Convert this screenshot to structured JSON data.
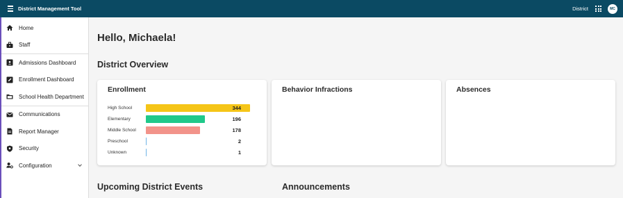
{
  "appbar": {
    "title": "District Management Tool",
    "district_label": "District",
    "avatar_initials": "MC",
    "color": "#0b4a63"
  },
  "sidebar": {
    "items": [
      {
        "label": "Home",
        "icon": "home-icon"
      },
      {
        "label": "Staff",
        "icon": "briefcase-icon"
      },
      {
        "label": "Admissions Dashboard",
        "icon": "inbox-icon"
      },
      {
        "label": "Enrollment Dashboard",
        "icon": "edit-icon"
      },
      {
        "label": "School Health Department",
        "icon": "folder-icon"
      },
      {
        "label": "Communications",
        "icon": "mail-icon"
      },
      {
        "label": "Report Manager",
        "icon": "document-icon"
      },
      {
        "label": "Security",
        "icon": "shield-icon"
      },
      {
        "label": "Configuration",
        "icon": "user-gear-icon"
      }
    ]
  },
  "main": {
    "greeting": "Hello, Michaela!",
    "overview_title": "District Overview",
    "events_title": "Upcoming District Events",
    "announcements_title": "Announcements"
  },
  "cards": {
    "enrollment": {
      "title": "Enrollment",
      "rows": [
        {
          "label": "High School",
          "value": 344,
          "color": "#f5c518"
        },
        {
          "label": "Elementary",
          "value": 196,
          "color": "#1fc98a"
        },
        {
          "label": "Middle School",
          "value": 178,
          "color": "#f2938a"
        },
        {
          "label": "Preschool",
          "value": 2,
          "color": "#6fb3e6"
        },
        {
          "label": "Unknown",
          "value": 1,
          "color": "#6fb3e6"
        }
      ],
      "max": 344
    },
    "behavior": {
      "title": "Behavior Infractions"
    },
    "absences": {
      "title": "Absences"
    }
  }
}
